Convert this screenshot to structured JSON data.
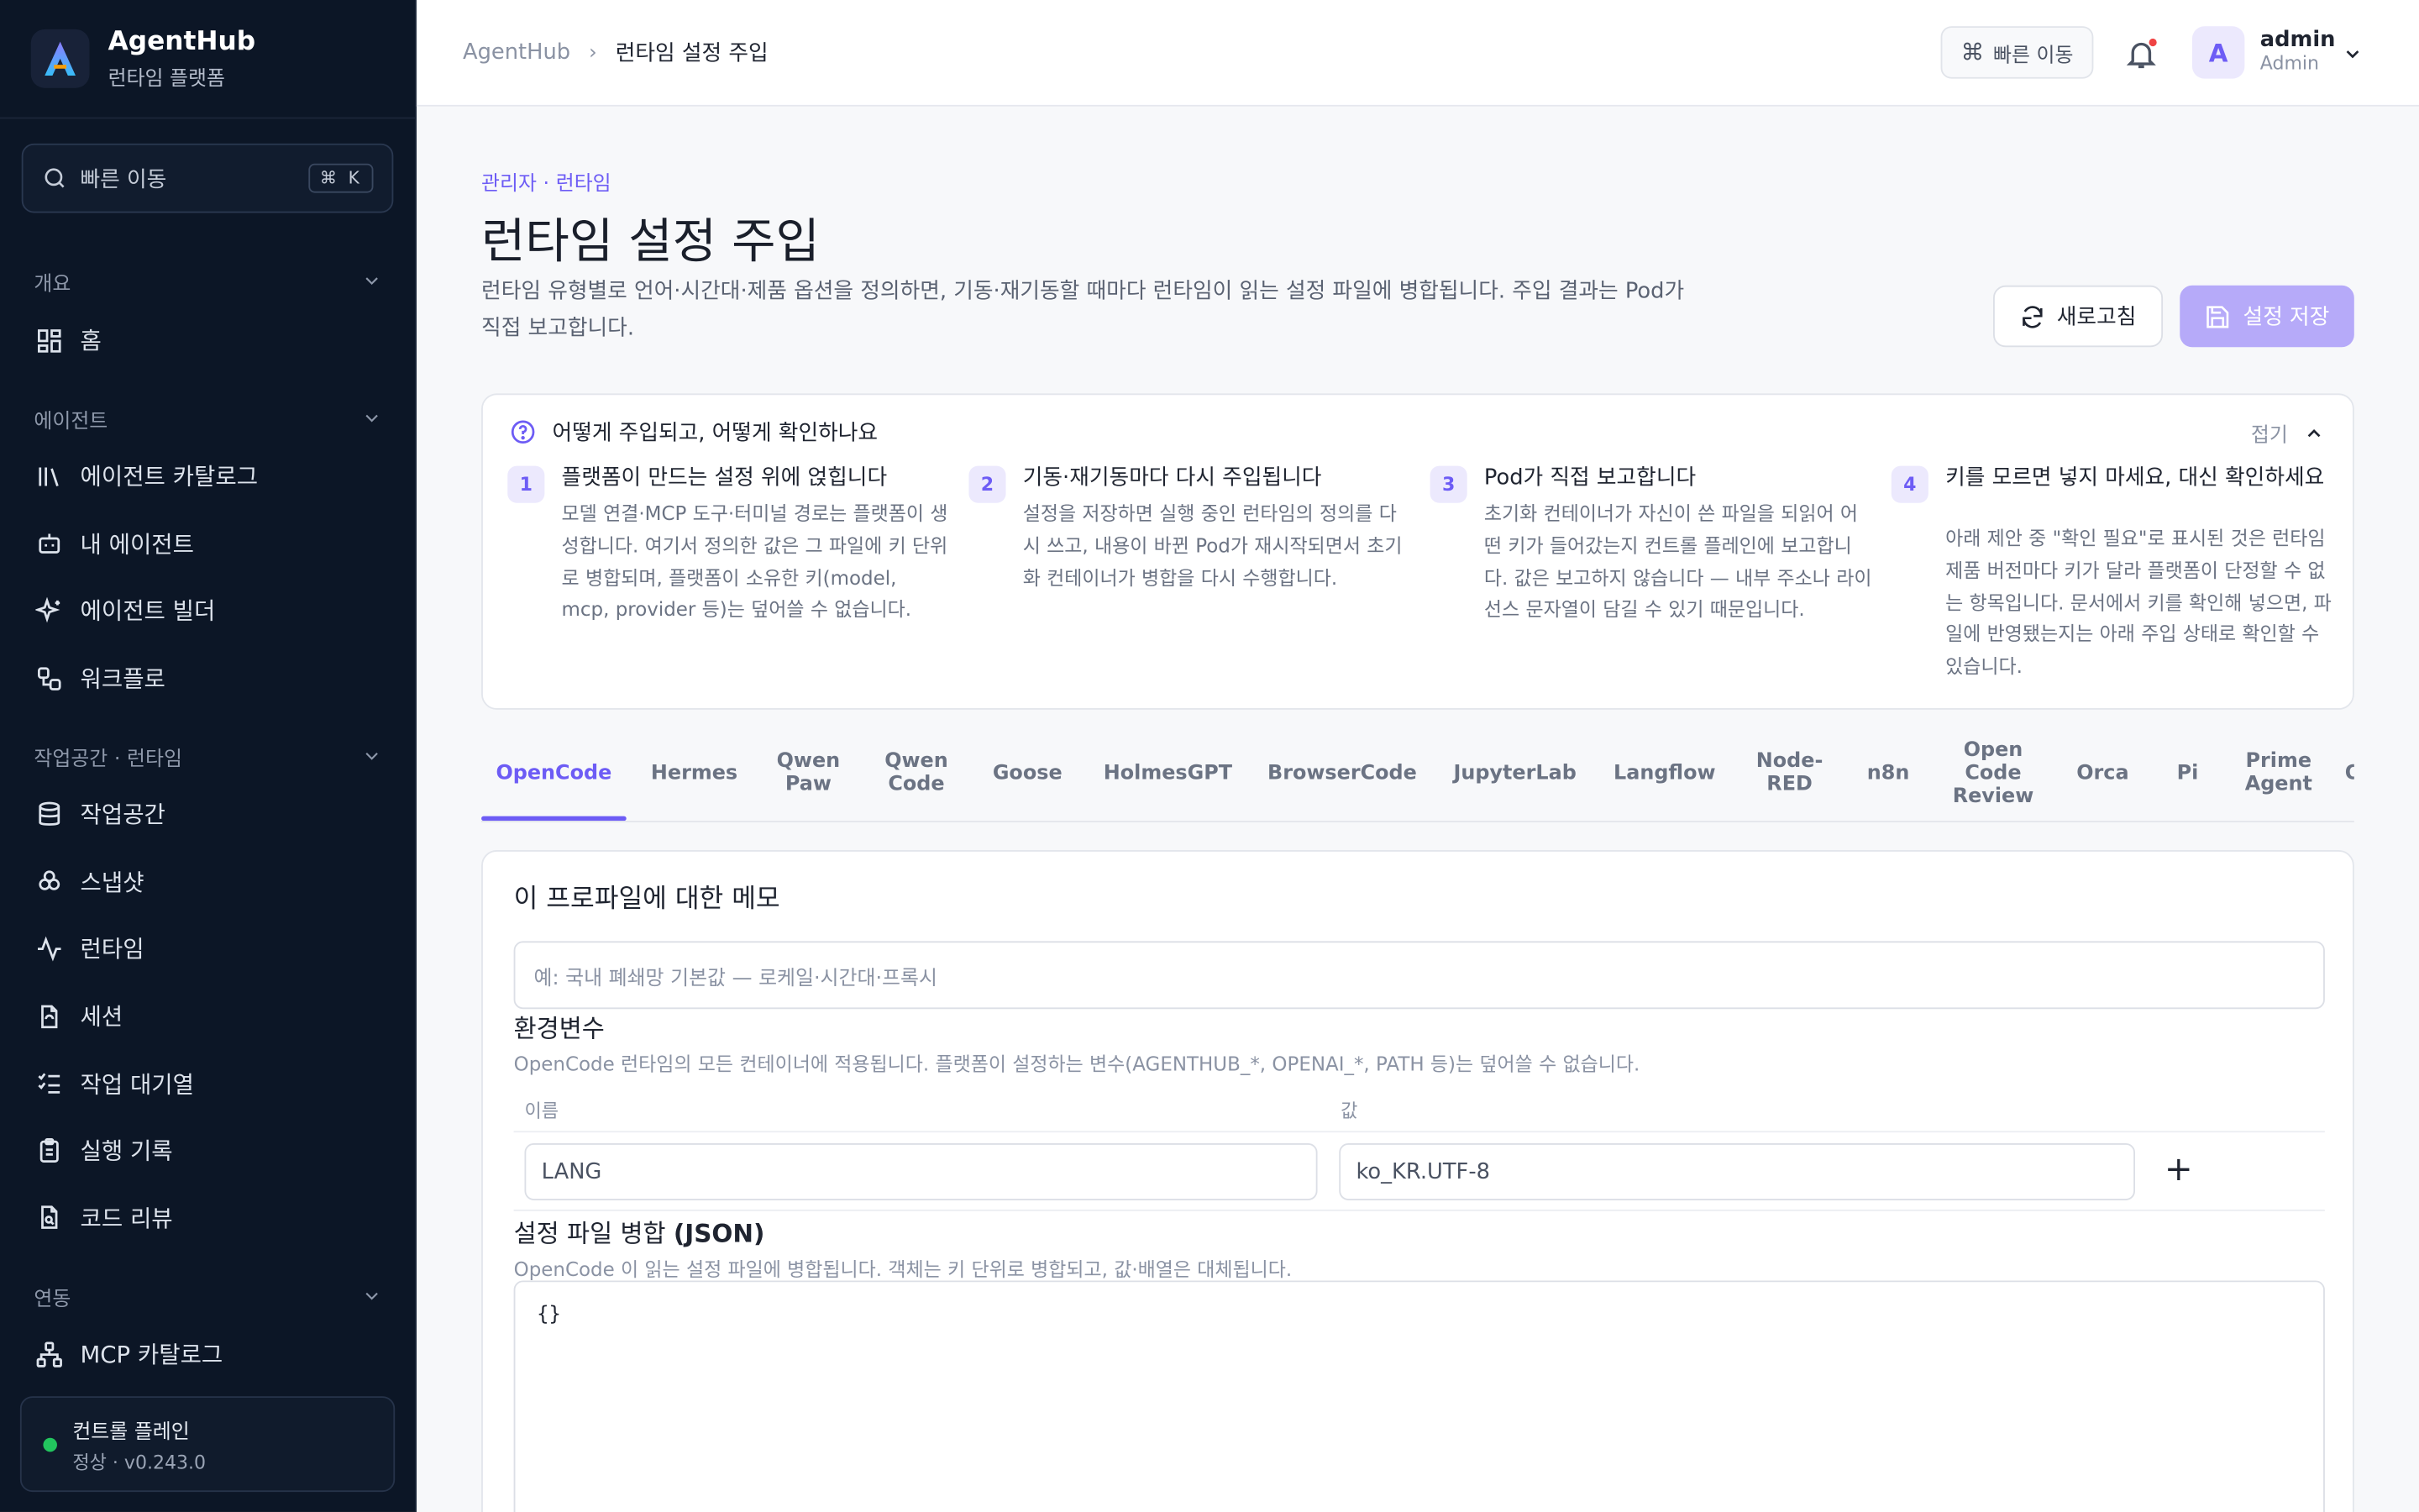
{
  "brand": {
    "name": "AgentHub",
    "subtitle": "런타임 플랫폼"
  },
  "sidebar": {
    "search": {
      "placeholder": "빠른 이동",
      "shortcut": "⌘ K"
    },
    "sections": [
      {
        "title": "개요",
        "items": [
          {
            "label": "홈",
            "icon": "grid-icon"
          }
        ]
      },
      {
        "title": "에이전트",
        "items": [
          {
            "label": "에이전트 카탈로그",
            "icon": "library-icon"
          },
          {
            "label": "내 에이전트",
            "icon": "bot-icon"
          },
          {
            "label": "에이전트 빌더",
            "icon": "sparkles-icon"
          },
          {
            "label": "워크플로",
            "icon": "workflow-icon"
          }
        ]
      },
      {
        "title": "작업공간 · 런타임",
        "items": [
          {
            "label": "작업공간",
            "icon": "database-icon"
          },
          {
            "label": "스냅샷",
            "icon": "boxes-icon"
          },
          {
            "label": "런타임",
            "icon": "activity-icon"
          },
          {
            "label": "세션",
            "icon": "file-sync-icon"
          },
          {
            "label": "작업 대기열",
            "icon": "checklist-icon"
          },
          {
            "label": "실행 기록",
            "icon": "clipboard-icon"
          },
          {
            "label": "코드 리뷰",
            "icon": "file-search-icon"
          }
        ]
      },
      {
        "title": "연동",
        "items": [
          {
            "label": "MCP 카탈로그",
            "icon": "network-icon"
          }
        ]
      }
    ],
    "control_plane": {
      "title": "컨트롤 플레인",
      "status": "정상 · v0.243.0",
      "status_color": "#22c55e"
    }
  },
  "header": {
    "breadcrumb": [
      "AgentHub",
      "런타임 설정 주입"
    ],
    "quick_label": "빠른 이동",
    "user": {
      "initial": "A",
      "name": "admin",
      "role": "Admin"
    }
  },
  "page": {
    "kicker": "관리자 · 런타임",
    "title": "런타임 설정 주입",
    "description": "런타임 유형별로 언어·시간대·제품 옵션을 정의하면, 기동·재기동할 때마다 런타임이 읽는 설정 파일에 병합됩니다. 주입 결과는 Pod가 직접 보고합니다.",
    "refresh_label": "새로고침",
    "save_label": "설정 저장"
  },
  "howto": {
    "title": "어떻게 주입되고, 어떻게 확인하나요",
    "collapse_label": "접기",
    "steps": [
      {
        "num": "1",
        "title": "플랫폼이 만드는 설정 위에 얹힙니다",
        "body": "모델 연결·MCP 도구·터미널 경로는 플랫폼이 생성합니다. 여기서 정의한 값은 그 파일에 키 단위로 병합되며, 플랫폼이 소유한 키(model, mcp, provider 등)는 덮어쓸 수 없습니다."
      },
      {
        "num": "2",
        "title": "기동·재기동마다 다시 주입됩니다",
        "body": "설정을 저장하면 실행 중인 런타임의 정의를 다시 쓰고, 내용이 바뀐 Pod가 재시작되면서 초기화 컨테이너가 병합을 다시 수행합니다."
      },
      {
        "num": "3",
        "title": "Pod가 직접 보고합니다",
        "body": "초기화 컨테이너가 자신이 쓴 파일을 되읽어 어떤 키가 들어갔는지 컨트롤 플레인에 보고합니다. 값은 보고하지 않습니다 — 내부 주소나 라이선스 문자열이 담길 수 있기 때문입니다."
      },
      {
        "num": "4",
        "title": "키를 모르면 넣지 마세요, 대신 확인하세요",
        "body": "아래 제안 중 \"확인 필요\"로 표시된 것은 런타임 제품 버전마다 키가 달라 플랫폼이 단정할 수 없는 항목입니다. 문서에서 키를 확인해 넣으면, 파일에 반영됐는지는 아래 주입 상태로 확인할 수 있습니다."
      }
    ]
  },
  "tabs": [
    "OpenCode",
    "Hermes",
    "Qwen Paw",
    "Qwen Code",
    "Goose",
    "HolmesGPT",
    "BrowserCode",
    "JupyterLab",
    "Langflow",
    "Node-RED",
    "n8n",
    "Open Code Review",
    "Orca",
    "Pi",
    "Prime Agent",
    "OpenH"
  ],
  "active_tab": "OpenCode",
  "form": {
    "memo_title": "이 프로파일에 대한 메모",
    "memo_placeholder": "예: 국내 폐쇄망 기본값 — 로케일·시간대·프록시",
    "env_title": "환경변수",
    "env_desc": "OpenCode 런타임의 모든 컨테이너에 적용됩니다. 플랫폼이 설정하는 변수(AGENTHUB_*, OPENAI_*, PATH 등)는 덮어쓸 수 없습니다.",
    "col_name": "이름",
    "col_value": "값",
    "env_rows": [
      {
        "name": "LANG",
        "value": "ko_KR.UTF-8"
      }
    ],
    "add_label": "+",
    "json_title_main": "설정 파일 병합 ",
    "json_title_bold": "(JSON)",
    "json_desc": "OpenCode 이 읽는 설정 파일에 병합됩니다. 객체는 키 단위로 병합되고, 값·배열은 대체됩니다.",
    "json_value": "{}"
  },
  "colors": {
    "accent": "#6d5cf5",
    "sidebar_bg": "#0c1626",
    "save_disabled": "#b6aaf9"
  }
}
